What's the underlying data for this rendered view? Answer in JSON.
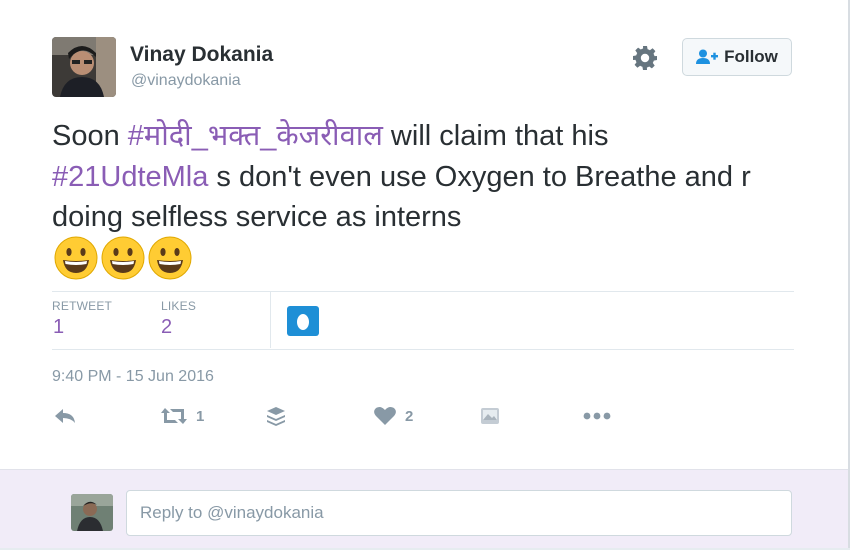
{
  "user": {
    "display_name": "Vinay Dokania",
    "handle": "@vinaydokania"
  },
  "actions": {
    "follow_label": "Follow",
    "settings_icon": "gear-icon",
    "follow_icon": "add-user-icon"
  },
  "tweet": {
    "segments": {
      "s1": "Soon ",
      "h1": "#मोदी_भक्त_केजरीवाल",
      "s2": " will claim that his ",
      "h2": "#21UdteMla",
      "s3": " s don't even use Oxygen to Breathe and r doing selfless service as interns"
    },
    "emojis": [
      "grinning-face",
      "grinning-face",
      "grinning-face"
    ]
  },
  "stats": {
    "retweet_label": "RETWEET",
    "retweet_count": "1",
    "likes_label": "LIKES",
    "likes_count": "2"
  },
  "timestamp": "9:40 PM - 15 Jun 2016",
  "footer_actions": {
    "reply_icon": "reply-icon",
    "retweet_icon": "retweet-icon",
    "retweet_count": "1",
    "buffer_icon": "buffer-stack-icon",
    "like_icon": "heart-icon",
    "like_count": "2",
    "media_icon": "image-icon",
    "more_icon": "more-dots-icon"
  },
  "reply": {
    "placeholder": "Reply to @vinaydokania"
  },
  "colors": {
    "hashtag": "#8a5db5",
    "muted": "#8899a6",
    "reply_bg": "#f1ecf8",
    "liker_badge": "#1e8fd6"
  }
}
